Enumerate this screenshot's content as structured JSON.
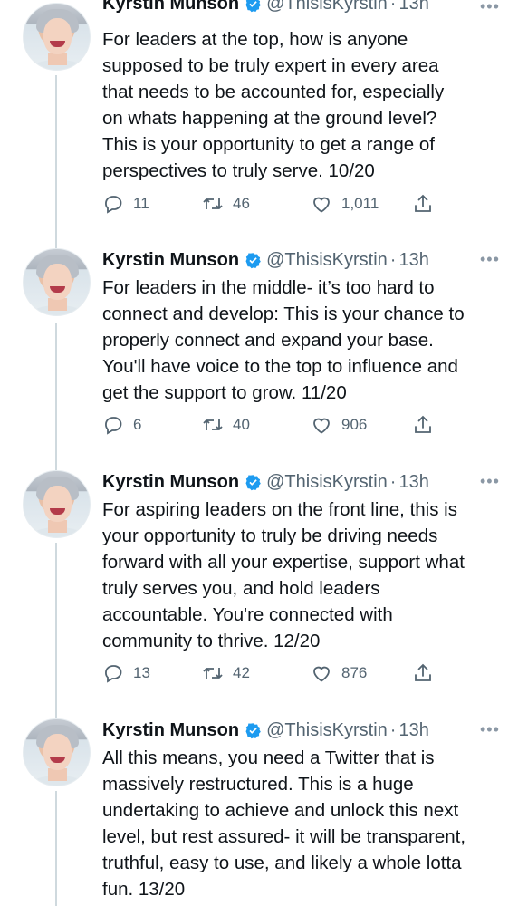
{
  "tweets": [
    {
      "author_name": "Kyrstin Munson",
      "handle": "@ThisisKyrstin",
      "time": "13h",
      "lines": [
        "For leaders at the top, how is anyone",
        "supposed to be truly expert in every area",
        "that needs to be accounted for, especially",
        "on whats happening at the ground level?",
        "This is your opportunity to get a range of",
        "perspectives to truly serve. 10/20"
      ],
      "replies": "11",
      "retweets": "46",
      "likes": "1,011"
    },
    {
      "author_name": "Kyrstin Munson",
      "handle": "@ThisisKyrstin",
      "time": "13h",
      "lines": [
        "For leaders in the middle- it’s too hard to",
        "connect and develop: This is your chance to",
        "properly connect and expand your base.",
        "You'll have voice to the top to influence and",
        "get the support to grow.  11/20"
      ],
      "replies": "6",
      "retweets": "40",
      "likes": "906"
    },
    {
      "author_name": "Kyrstin Munson",
      "handle": "@ThisisKyrstin",
      "time": "13h",
      "lines": [
        "For aspiring leaders on the front line, this is",
        "your opportunity to truly be driving needs",
        "forward with all your expertise, support what",
        "truly serves you, and hold leaders",
        "accountable. You're connected with",
        "community to thrive. 12/20"
      ],
      "replies": "13",
      "retweets": "42",
      "likes": "876"
    },
    {
      "author_name": "Kyrstin Munson",
      "handle": "@ThisisKyrstin",
      "time": "13h",
      "lines": [
        "All this means, you need a Twitter that is",
        "massively restructured. This is a huge",
        "undertaking to achieve and unlock this next",
        "level, but rest assured- it will be transparent,",
        "truthful, easy to use, and likely a whole lotta",
        "fun. 13/20"
      ]
    }
  ],
  "separator": "·",
  "icons": {
    "verified": "verified-badge-icon",
    "more": "more-options-icon",
    "reply": "reply-icon",
    "retweet": "retweet-icon",
    "like": "like-icon",
    "share": "share-icon"
  },
  "colors": {
    "verified": "#1d9bf0",
    "text": "#0f1419",
    "secondary": "#536471",
    "thread_line": "#cfd9de"
  }
}
